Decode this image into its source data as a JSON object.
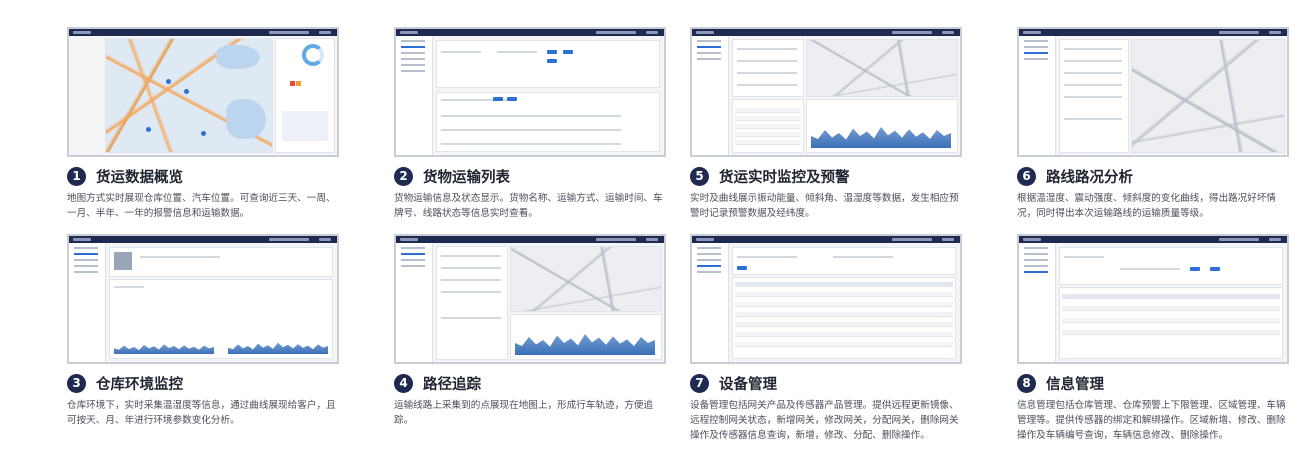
{
  "cards": [
    {
      "number": "1",
      "title": "货运数据概览",
      "description": "地图方式实时展现仓库位置、汽车位置。可查询近三天、一周、一月、半年、一年的报警信息和运输数据。",
      "icon": "map-overview-screenshot"
    },
    {
      "number": "2",
      "title": "货物运输列表",
      "description": "货物运输信息及状态显示。货物名称、运输方式、运输时间、车牌号、线路状态等信息实时查看。",
      "icon": "list-screenshot"
    },
    {
      "number": "5",
      "title": "货运实时监控及预警",
      "description": "实时及曲线展示振动能量、倾斜角、温湿度等数据，发生相应预警时记录预警数据及经纬度。",
      "icon": "monitor-screenshot"
    },
    {
      "number": "6",
      "title": "路线路况分析",
      "description": "根据温湿度、震动强度、倾斜度的变化曲线，得出路况好坏情况，同时得出本次运输路线的运输质量等级。",
      "icon": "route-analysis-screenshot"
    },
    {
      "number": "3",
      "title": "仓库环境监控",
      "description": "仓库环境下，实时采集温湿度等信息，通过曲线展现给客户，且可按天、月、年进行环境参数变化分析。",
      "icon": "warehouse-screenshot"
    },
    {
      "number": "4",
      "title": "路径追踪",
      "description": "运输线路上采集到的点展现在地图上，形成行车轨迹，方便追踪。",
      "icon": "track-screenshot"
    },
    {
      "number": "7",
      "title": "设备管理",
      "description": "设备管理包括网关产品及传感器产品管理。提供远程更新镜像、远程控制网关状态，新增网关，修改网关，分配网关，删除网关操作及传感器信息查询，新增，修改、分配、删除操作。",
      "icon": "device-screenshot"
    },
    {
      "number": "8",
      "title": "信息管理",
      "description": "信息管理包括仓库管理、仓库预警上下限管理、区域管理、车辆管理等。提供传感器的绑定和解绑操作。区域新增、修改、删除操作及车辆编号查询，车辆信息修改、删除操作。",
      "icon": "info-screenshot"
    }
  ]
}
